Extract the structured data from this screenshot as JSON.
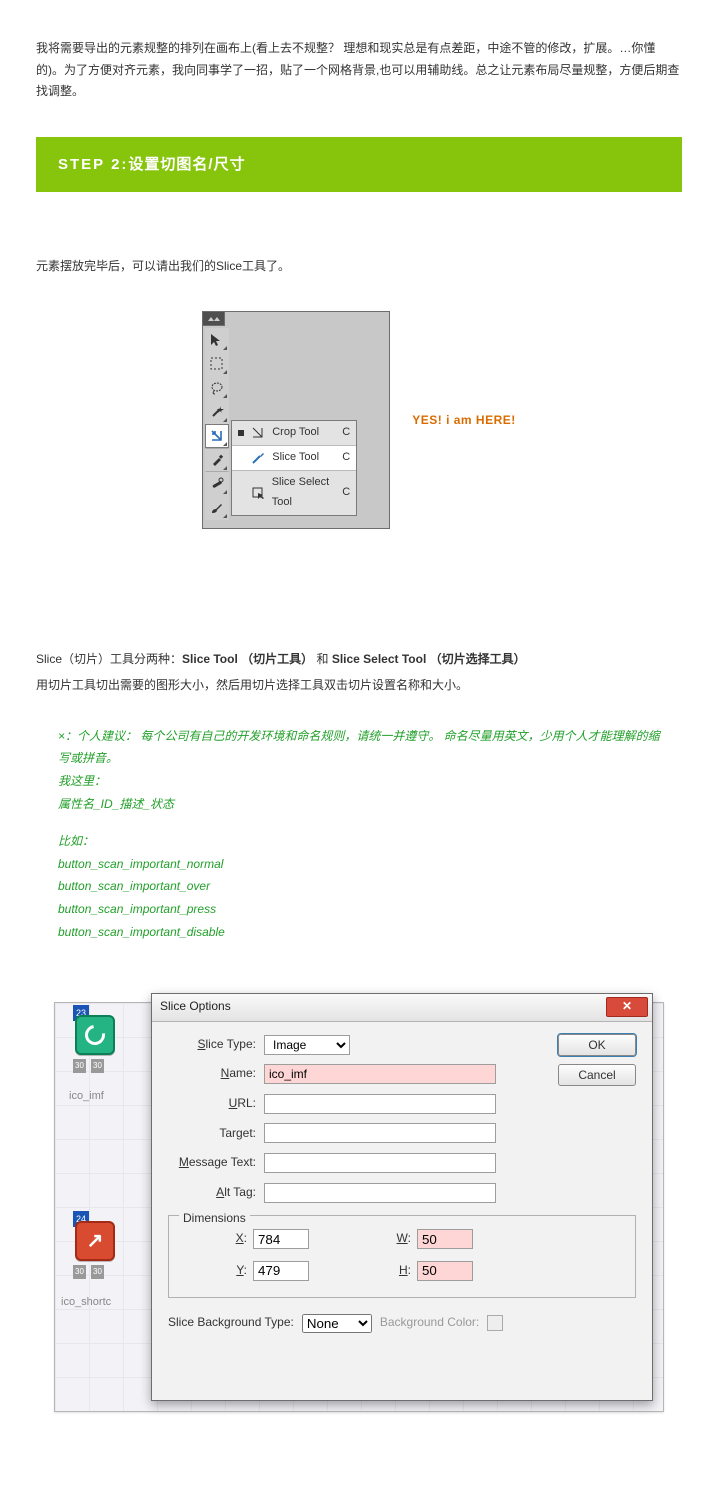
{
  "intro": "我将需要导出的元素规整的排列在画布上(看上去不规整？ 理想和现实总是有点差距，中途不管的修改，扩展。…你懂的)。为了方便对齐元素，我向同事学了一招，贴了一个网格背景,也可以用辅助线。总之让元素布局尽量规整，方便后期查找调整。",
  "step_prefix": "STEP 2:",
  "step_title": "设置切图名/尺寸",
  "after_banner": "元素摆放完毕后，可以请出我们的Slice工具了。",
  "flyout": {
    "crop": "Crop Tool",
    "slice": "Slice Tool",
    "sliceselect": "Slice Select Tool",
    "shortcut": "C"
  },
  "yes_here": "YES! i am HERE!",
  "p2_a": "Slice（切片）工具分两种：",
  "p2_b": "Slice Tool （切片工具）",
  "p2_c": " 和 ",
  "p2_d": "Slice Select Tool （切片选择工具）",
  "p3": "用切片工具切出需要的图形大小，然后用切片选择工具双击切片设置名称和大小。",
  "note": {
    "l1": "×：个人建议： 每个公司有自己的开发环境和命名规则，请统一并遵守。 命名尽量用英文，少用个人才能理解的缩写或拼音。",
    "l2": "我这里：",
    "l3": "属性名_ID_描述_状态",
    "l4": "比如：",
    "b1": "button_scan_important_normal",
    "b2": "button_scan_important_over",
    "b3": "button_scan_important_press",
    "b4": "button_scan_important_disable"
  },
  "canvas": {
    "slice23": "23",
    "slice24": "24",
    "g30a": "30",
    "g30b": "30",
    "lbl_imf": "ico_imf",
    "lbl_shortc": "ico_shortc"
  },
  "dlg": {
    "title": "Slice Options",
    "ok": "OK",
    "cancel": "Cancel",
    "slice_type": "Slice Type:",
    "slice_type_val": "Image",
    "name": "Name:",
    "name_val": "ico_imf",
    "url": "URL:",
    "target": "Target:",
    "msg": "Message Text:",
    "alt": "Alt Tag:",
    "dims": "Dimensions",
    "x": "X:",
    "x_val": "784",
    "y": "Y:",
    "y_val": "479",
    "w": "W:",
    "w_val": "50",
    "h": "H:",
    "h_val": "50",
    "sbg": "Slice Background Type:",
    "sbg_val": "None",
    "bgcolor": "Background Color:"
  }
}
